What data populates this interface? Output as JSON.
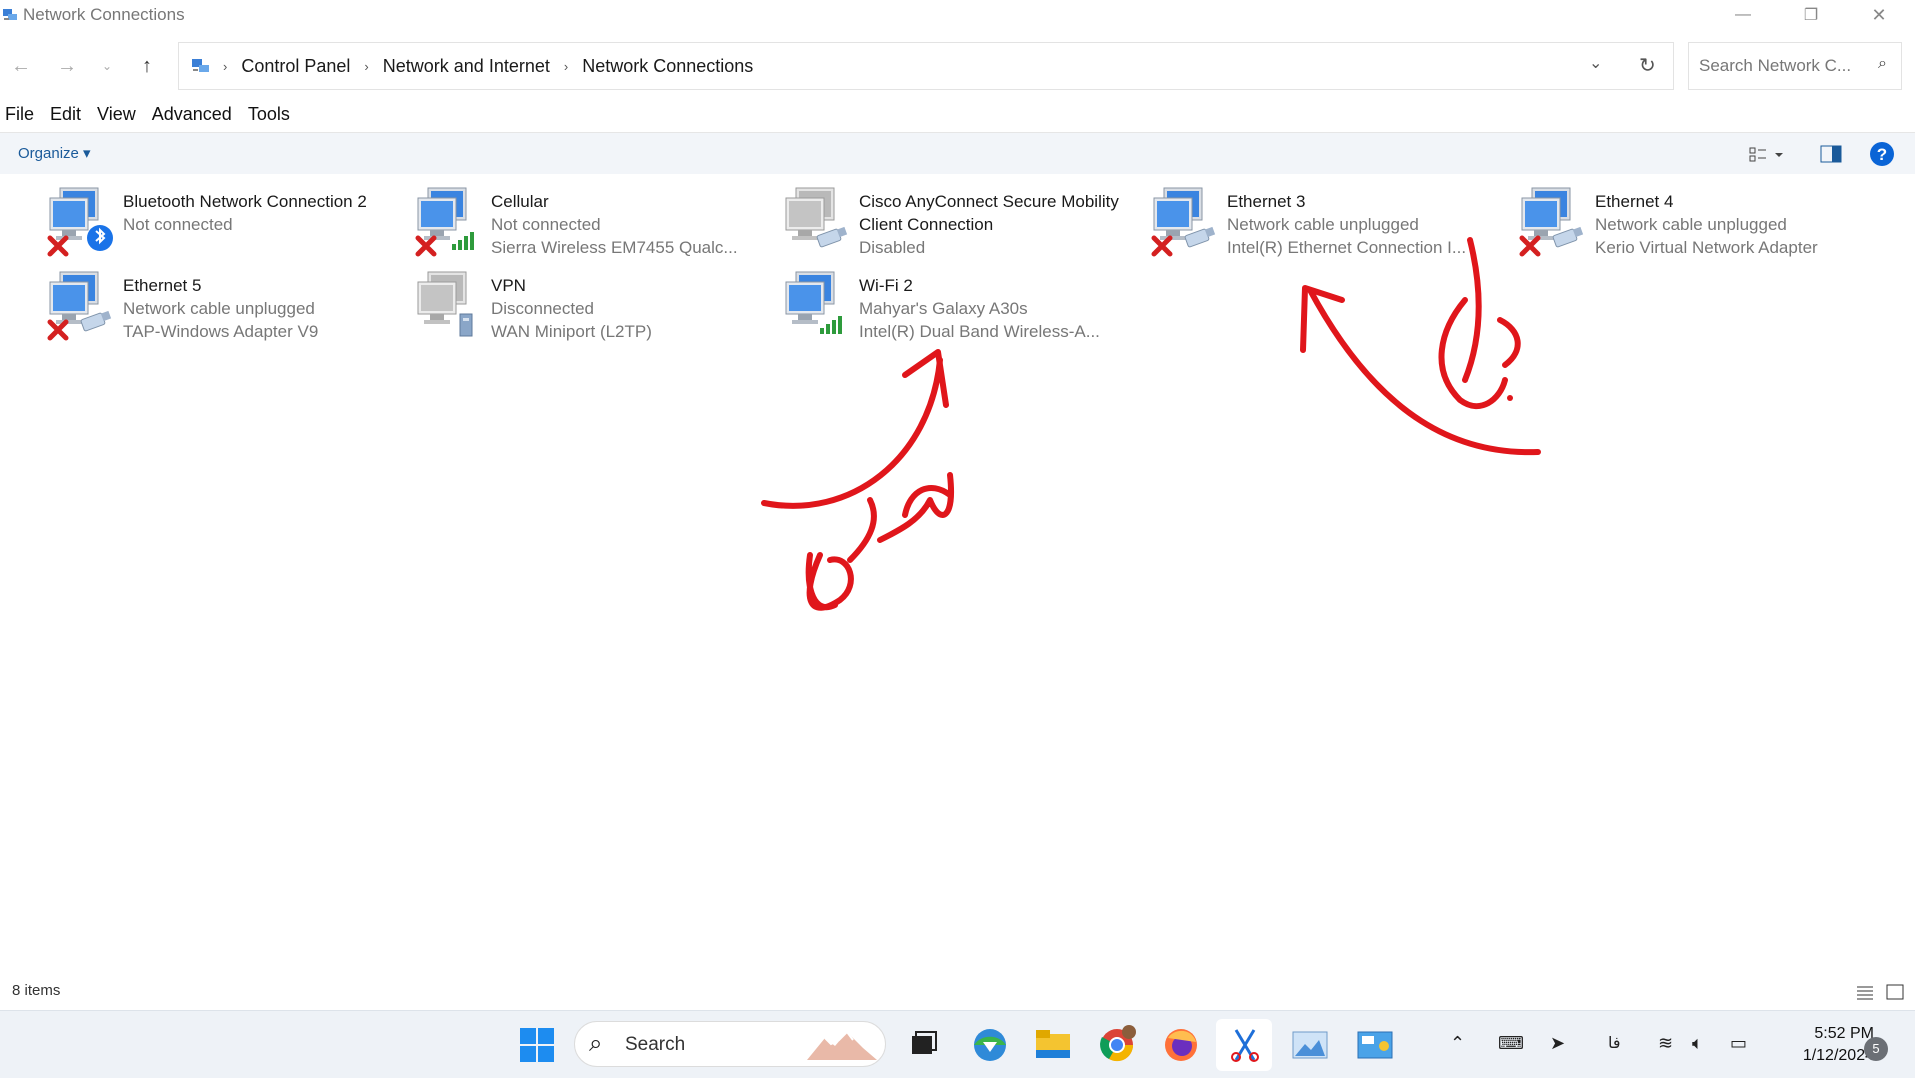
{
  "window": {
    "title": "Network Connections",
    "minimize_glyph": "—",
    "restore_glyph": "❐",
    "close_glyph": "✕"
  },
  "nav": {
    "breadcrumbs": [
      "Control Panel",
      "Network and Internet",
      "Network Connections"
    ],
    "search_placeholder": "Search Network C..."
  },
  "menu": [
    "File",
    "Edit",
    "View",
    "Advanced",
    "Tools"
  ],
  "commandbar": {
    "organize_label": "Organize ▾"
  },
  "connections": [
    {
      "name": "Bluetooth Network Connection 2",
      "line1": "Not connected",
      "line2": "",
      "icon": "bluetooth-network-icon",
      "status": "error"
    },
    {
      "name": "Cellular",
      "line1": "Not connected",
      "line2": "Sierra Wireless EM7455 Qualc...",
      "icon": "cellular-network-icon",
      "status": "error"
    },
    {
      "name": "Cisco AnyConnect Secure Mobility Client Connection",
      "line1": "Disabled",
      "line2": "",
      "icon": "ethernet-network-icon",
      "status": "disabled"
    },
    {
      "name": "Ethernet 3",
      "line1": "Network cable unplugged",
      "line2": "Intel(R) Ethernet Connection I...",
      "icon": "ethernet-network-icon",
      "status": "error"
    },
    {
      "name": "Ethernet 4",
      "line1": "Network cable unplugged",
      "line2": "Kerio Virtual Network Adapter",
      "icon": "ethernet-network-icon",
      "status": "error"
    },
    {
      "name": "Ethernet 5",
      "line1": "Network cable unplugged",
      "line2": "TAP-Windows Adapter V9",
      "icon": "ethernet-network-icon",
      "status": "error"
    },
    {
      "name": "VPN",
      "line1": "Disconnected",
      "line2": "WAN Miniport (L2TP)",
      "icon": "vpn-network-icon",
      "status": "disabled"
    },
    {
      "name": "Wi-Fi 2",
      "line1": "Mahyar's Galaxy A30s",
      "line2": "Intel(R) Dual Band Wireless-A...",
      "icon": "wifi-network-icon",
      "status": "ok"
    }
  ],
  "statusbar": {
    "count": "8 items"
  },
  "taskbar": {
    "search_label": "Search",
    "time": "5:52 PM",
    "date": "1/12/2024",
    "notifications": "5",
    "language": "فا"
  },
  "colors": {
    "accent": "#0a64d6",
    "annotation": "#e0161b",
    "error": "#d42020",
    "signal": "#2e9b3c"
  }
}
